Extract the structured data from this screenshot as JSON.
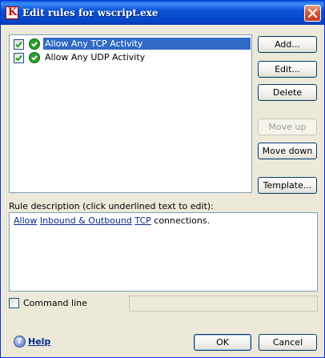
{
  "window": {
    "title": "Edit rules for wscript.exe",
    "app_icon": "kaspersky-k-icon",
    "close_icon": "close-icon"
  },
  "rules": [
    {
      "label": "Allow Any TCP Activity",
      "checked": true,
      "selected": true,
      "status_icon": "green-check-icon"
    },
    {
      "label": "Allow Any UDP Activity",
      "checked": true,
      "selected": false,
      "status_icon": "green-check-icon"
    }
  ],
  "buttons": {
    "add": "Add...",
    "edit": "Edit...",
    "delete": "Delete",
    "move_up": "Move up",
    "move_down": "Move down",
    "template": "Template..."
  },
  "description": {
    "label": "Rule description (click underlined text to edit):",
    "parts": {
      "action": "Allow",
      "direction": "Inbound & Outbound",
      "protocol": "TCP",
      "suffix": "connections."
    }
  },
  "command_line": {
    "label": "Command line",
    "checked": false,
    "value": ""
  },
  "footer": {
    "help": "Help",
    "ok": "OK",
    "cancel": "Cancel"
  }
}
